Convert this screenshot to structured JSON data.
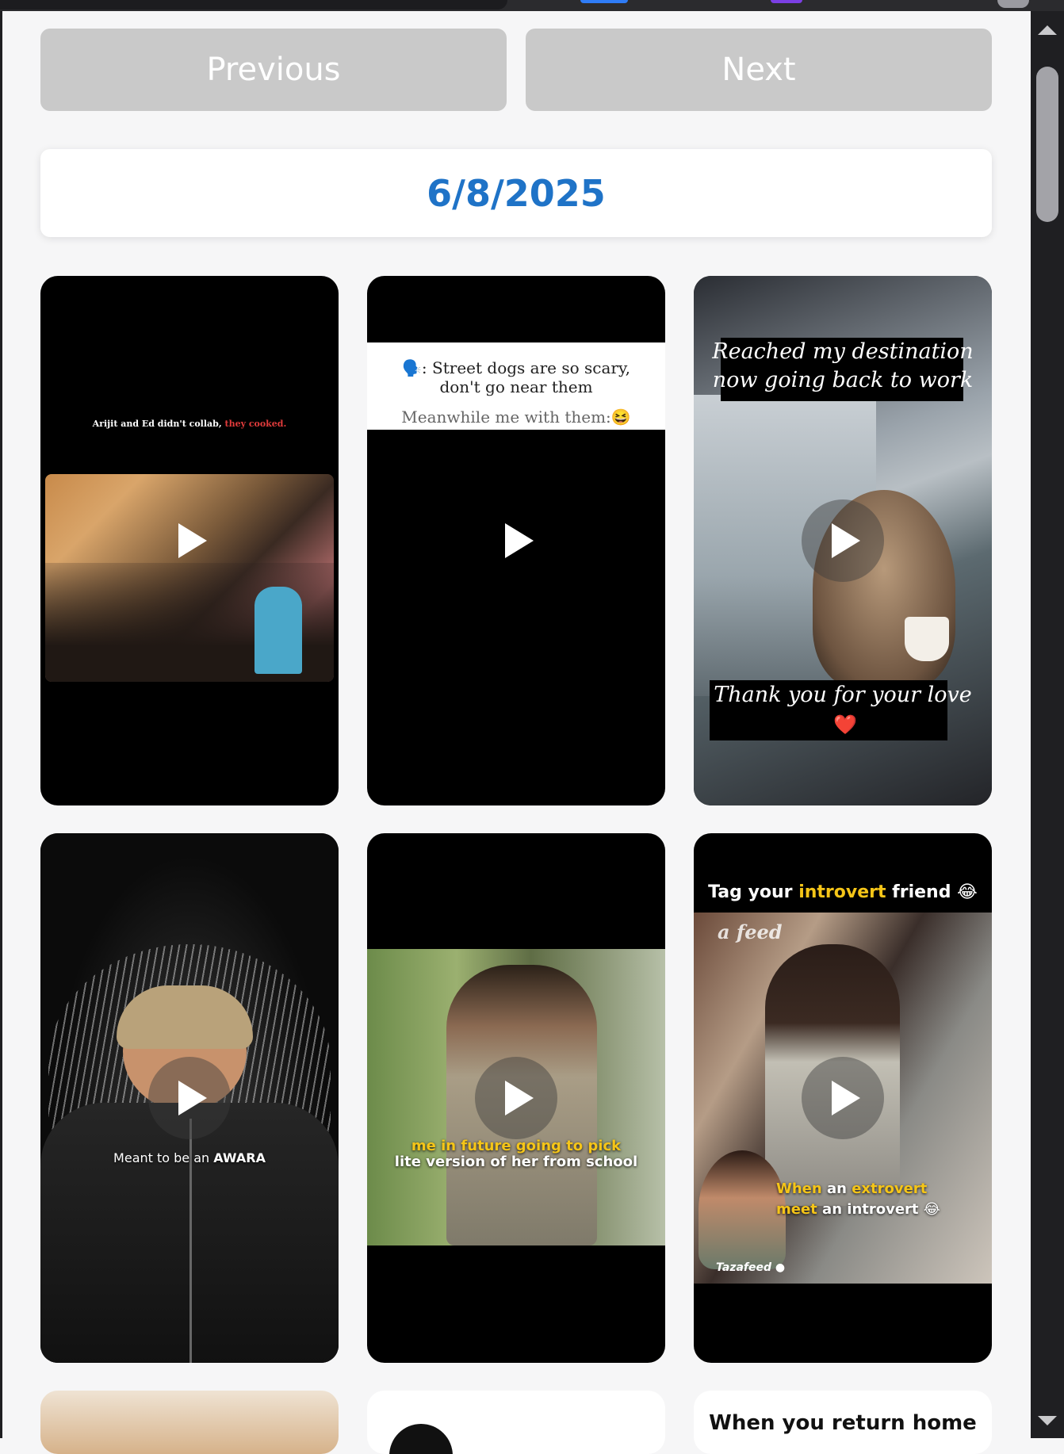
{
  "nav": {
    "previous_label": "Previous",
    "next_label": "Next"
  },
  "date": "6/8/2025",
  "cards": [
    {
      "caption_white": "Arijit and Ed didn't collab, ",
      "caption_red": "they cooked."
    },
    {
      "line1": "🗣️: Street dogs are so scary, don't go near them",
      "line2": "Meanwhile me with them:😆"
    },
    {
      "top": "Reached my destination now going back to work",
      "bottom": "Thank you for your love",
      "heart": "❤️"
    },
    {
      "caption_prefix": "Meant to be an ",
      "caption_bold": "AWARA"
    },
    {
      "line1": "me in future going to pick",
      "line2": "lite version of her from school"
    },
    {
      "title_a": "Tag your ",
      "title_b": "introvert",
      "title_c": " friend 😂",
      "watermark": "a  feed",
      "cap1_a": "When",
      "cap1_b": " an ",
      "cap1_c": "extrovert",
      "cap2_a": "meet",
      "cap2_b": " an introvert 😂",
      "brand": "Tazafeed ●"
    },
    {},
    {},
    {
      "title": "When you return home"
    }
  ],
  "icons": {
    "play": "play-icon",
    "scroll_up": "scroll-up-arrow",
    "scroll_down": "scroll-down-arrow"
  },
  "colors": {
    "accent": "#1f73c7",
    "button_bg": "#c9c9c9",
    "highlight_yellow": "#f5c518"
  }
}
